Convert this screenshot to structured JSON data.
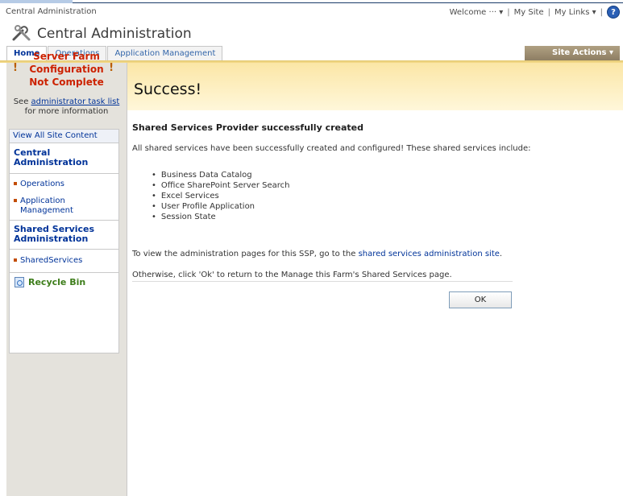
{
  "global": {
    "site_name": "Central Administration",
    "welcome": "Welcome",
    "user": "···",
    "my_site": "My Site",
    "my_links": "My Links",
    "sep": "|",
    "dropdown_arrow": "▾",
    "help": "?"
  },
  "header": {
    "title": "Central Administration",
    "logo_icon": "tools-icon"
  },
  "tabs": [
    {
      "label": "Home",
      "active": true
    },
    {
      "label": "Operations",
      "active": false
    },
    {
      "label": "Application Management",
      "active": false
    }
  ],
  "site_actions": "Site Actions ▾",
  "banner": {
    "title": "Success!"
  },
  "warning": {
    "line1": "Server Farm",
    "line2": "Configuration",
    "line3": "Not Complete",
    "bang": "!",
    "see": "See ",
    "link": "administrator task list",
    "more": "for more information"
  },
  "quicklaunch": {
    "view_all": "View All Site Content",
    "central_head": "Central Administration",
    "operations": "Operations",
    "app_mgmt_1": "Application",
    "app_mgmt_2": "Management",
    "shared_head": "Shared Services Administration",
    "shared_services": "SharedServices",
    "recycle_bin": "Recycle Bin"
  },
  "main": {
    "heading": "Shared Services Provider successfully created",
    "description": "All shared services have been successfully created and configured! These shared services include:",
    "services": [
      "Business Data Catalog",
      "Office SharePoint Server Search",
      "Excel Services",
      "User Profile Application",
      "Session State"
    ],
    "view_prefix": "To view the administration pages for this SSP, go to the ",
    "view_link": "shared services administration site",
    "view_suffix": ".",
    "otherwise": "Otherwise, click 'Ok' to return to the Manage this Farm's Shared Services page.",
    "ok": "OK"
  },
  "colors": {
    "accent_link": "#003399",
    "warning_red": "#cc2200",
    "banner": "#fbe6a6",
    "nav_bg": "#e4e2dc"
  }
}
